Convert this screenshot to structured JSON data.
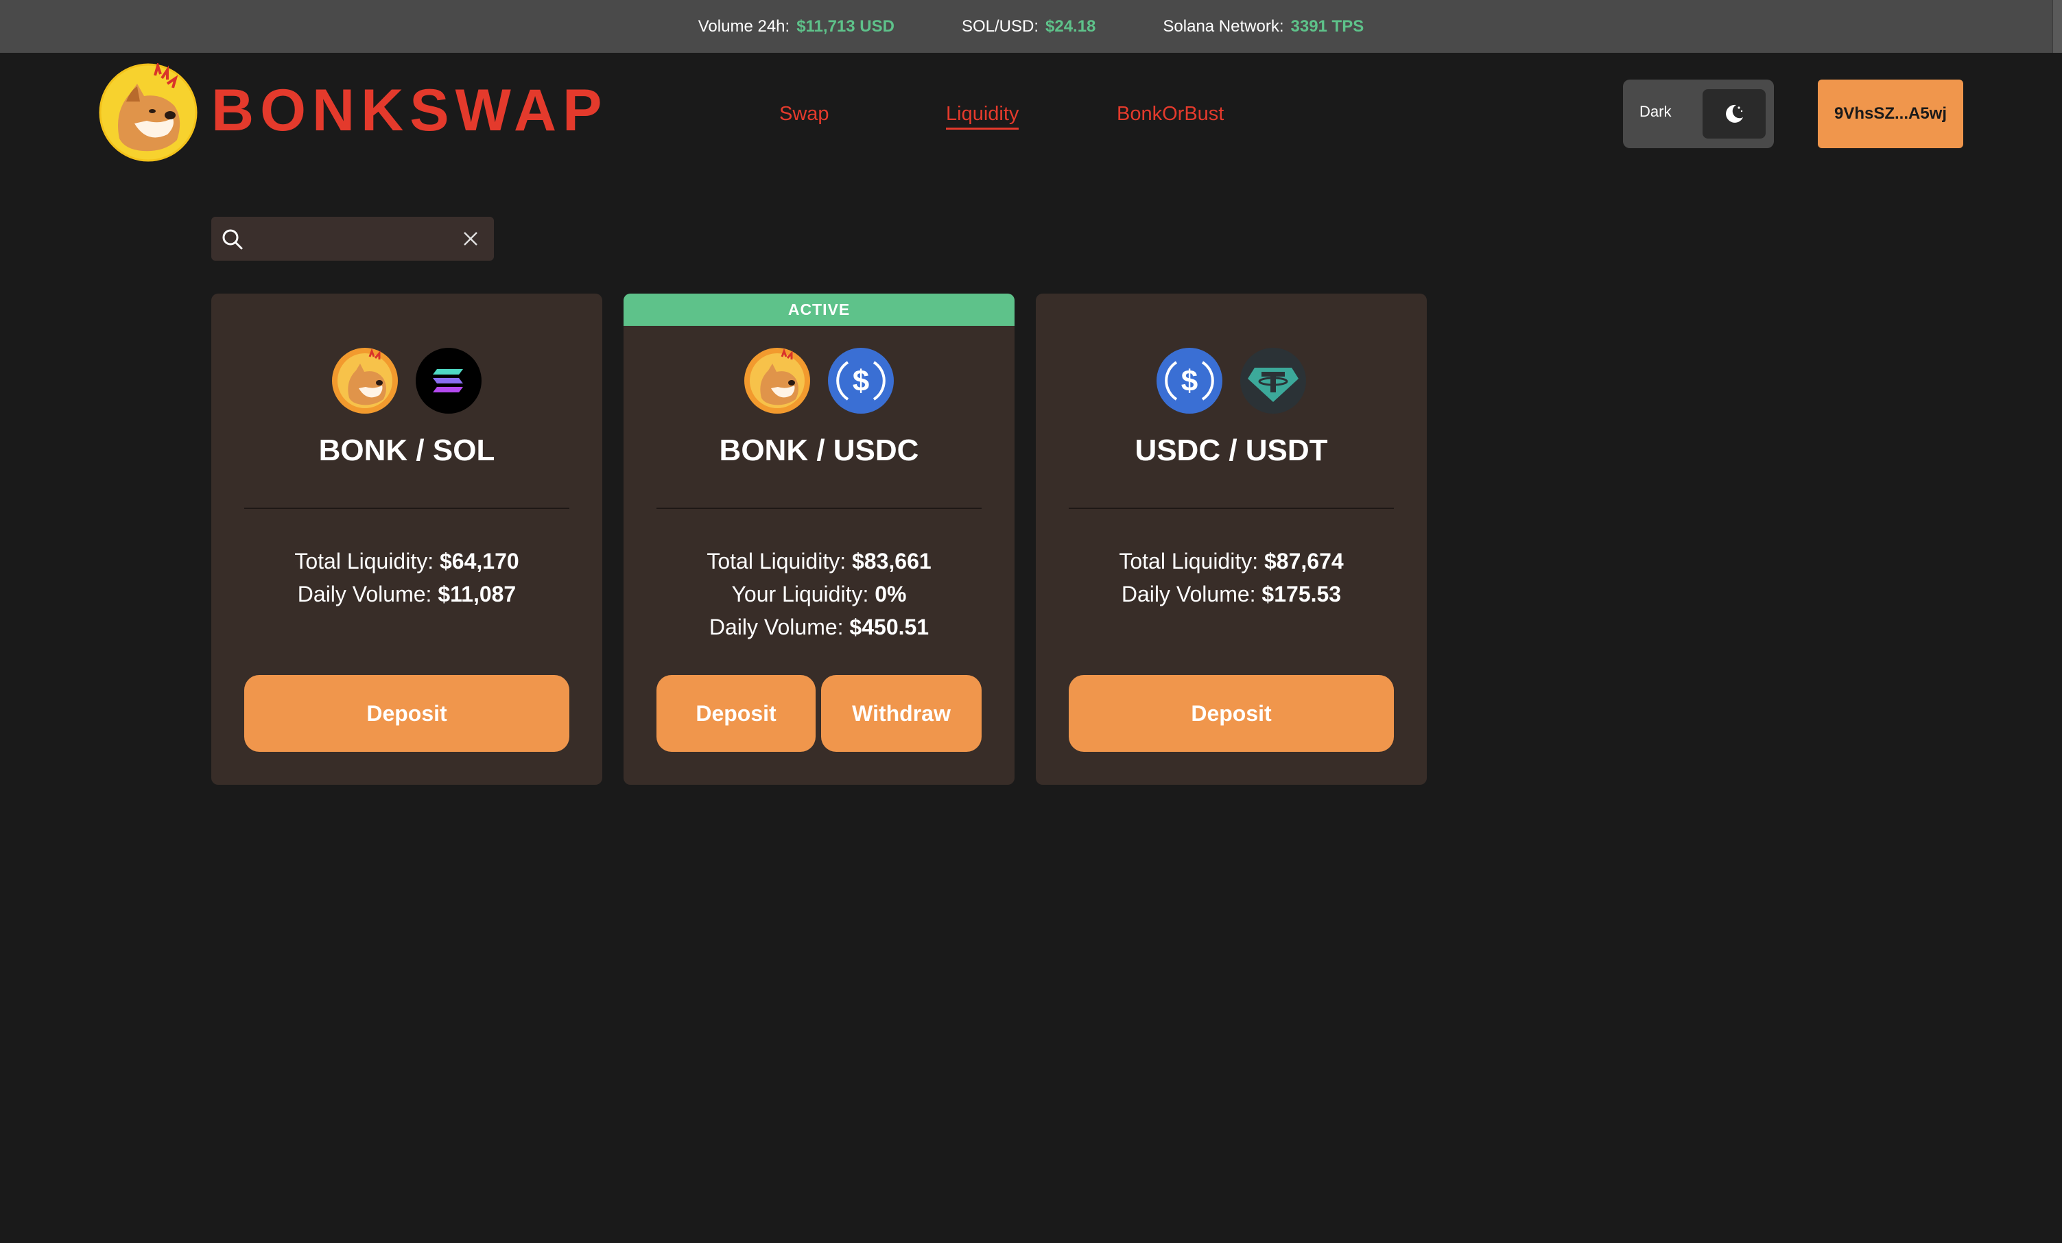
{
  "topbar": {
    "volume_label": "Volume 24h:",
    "volume_value": "$11,713 USD",
    "sol_label": "SOL/USD:",
    "sol_value": "$24.18",
    "network_label": "Solana Network:",
    "network_value": "3391 TPS"
  },
  "header": {
    "logo_text": "BONKSWAP",
    "nav": [
      {
        "label": "Swap",
        "active": false
      },
      {
        "label": "Liquidity",
        "active": true
      },
      {
        "label": "BonkOrBust",
        "active": false
      }
    ],
    "theme_label": "Dark",
    "wallet_label": "9VhsSZ...A5wj"
  },
  "search": {
    "value": "",
    "placeholder": ""
  },
  "pools": [
    {
      "pair": "BONK / SOL",
      "tokens": [
        "bonk-icon",
        "sol-icon"
      ],
      "active": false,
      "total_liquidity_label": "Total Liquidity:",
      "total_liquidity": "$64,170",
      "daily_volume_label": "Daily Volume:",
      "daily_volume": "$11,087",
      "buttons": [
        "Deposit"
      ]
    },
    {
      "pair": "BONK / USDC",
      "tokens": [
        "bonk-icon",
        "usdc-icon"
      ],
      "active": true,
      "badge": "ACTIVE",
      "total_liquidity_label": "Total Liquidity:",
      "total_liquidity": "$83,661",
      "your_liquidity_label": "Your Liquidity:",
      "your_liquidity": "0%",
      "daily_volume_label": "Daily Volume:",
      "daily_volume": "$450.51",
      "buttons": [
        "Deposit",
        "Withdraw"
      ]
    },
    {
      "pair": "USDC / USDT",
      "tokens": [
        "usdc-icon",
        "usdt-icon"
      ],
      "active": false,
      "total_liquidity_label": "Total Liquidity:",
      "total_liquidity": "$87,674",
      "daily_volume_label": "Daily Volume:",
      "daily_volume": "$175.53",
      "buttons": [
        "Deposit"
      ]
    }
  ],
  "colors": {
    "background": "#1a1a1a",
    "topbar": "#4a4a4a",
    "card": "#382d28",
    "accent_red": "#e43a2c",
    "accent_orange": "#f0964c",
    "accent_green": "#5ec28a",
    "usdc_blue": "#3a6fd4",
    "usdt_teal": "#3ca99a"
  }
}
